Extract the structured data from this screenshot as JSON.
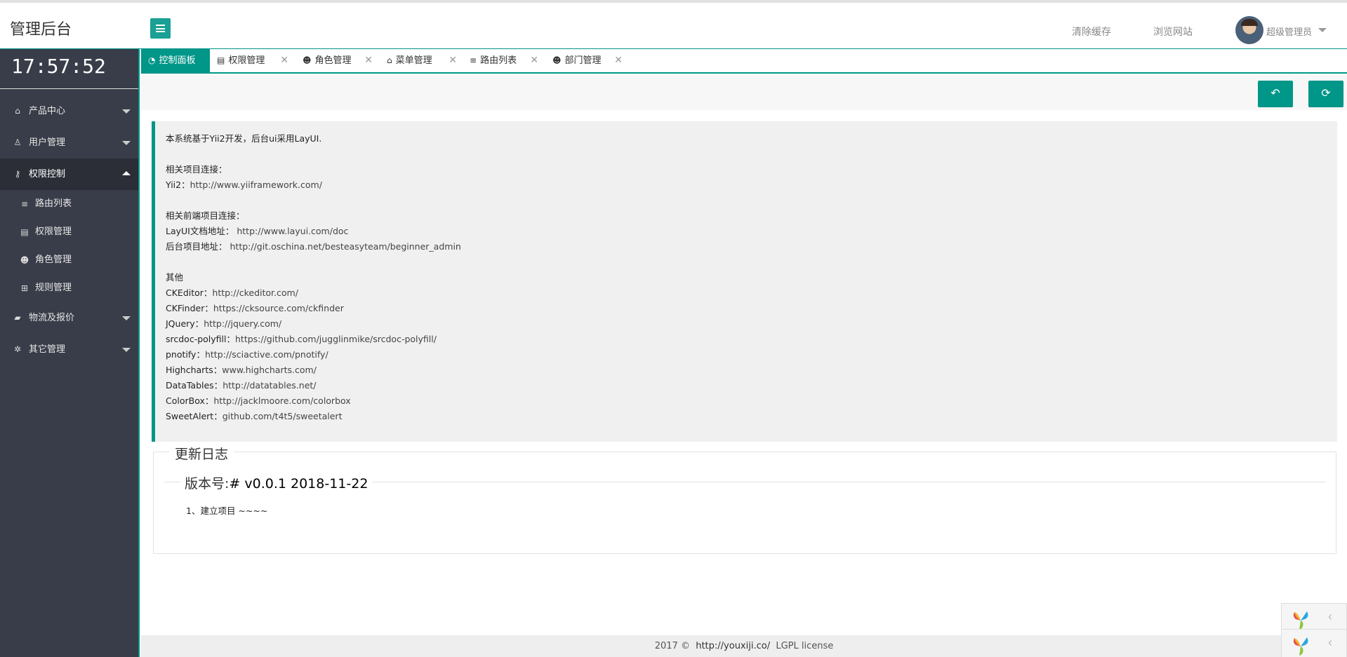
{
  "header": {
    "title": "管理后台",
    "clear_cache": "清除缓存",
    "browse_site": "浏览网站",
    "user_name": "超级管理员"
  },
  "sidebar": {
    "clock": "17:57:52",
    "items": [
      {
        "label": "产品中心",
        "icon": "home-icon"
      },
      {
        "label": "用户管理",
        "icon": "user-icon"
      },
      {
        "label": "权限控制",
        "icon": "key-icon"
      },
      {
        "label": "物流及报价",
        "icon": "truck-icon"
      },
      {
        "label": "其它管理",
        "icon": "gear-icon"
      }
    ],
    "sub_items": [
      {
        "label": "路由列表",
        "icon": "list-icon"
      },
      {
        "label": "权限管理",
        "icon": "id-card-icon"
      },
      {
        "label": "角色管理",
        "icon": "users-icon"
      },
      {
        "label": "规则管理",
        "icon": "basket-icon"
      }
    ]
  },
  "tabs": [
    {
      "label": "控制面板",
      "icon": "dashboard-icon",
      "active": true
    },
    {
      "label": "权限管理",
      "icon": "id-card-icon"
    },
    {
      "label": "角色管理",
      "icon": "users-icon"
    },
    {
      "label": "菜单管理",
      "icon": "home-icon"
    },
    {
      "label": "路由列表",
      "icon": "list-icon"
    },
    {
      "label": "部门管理",
      "icon": "users-icon"
    }
  ],
  "intro": {
    "line1": "本系统基于Yii2开发，后台ui采用LayUI.",
    "related_title": "相关项目连接：",
    "yii2_label": "Yii2：",
    "yii2_url": "http://www.yiiframework.com/",
    "frontend_title": "相关前端项目连接：",
    "layui_label": "LayUI文档地址：",
    "layui_url": "http://www.layui.com/doc",
    "backend_label": "后台项目地址：",
    "backend_url": "http://git.oschina.net/besteasyteam/beginner_admin",
    "other_title": "其他",
    "others": [
      {
        "label": "CKEditor：",
        "url": "http://ckeditor.com/"
      },
      {
        "label": "CKFinder：",
        "url": "https://cksource.com/ckfinder"
      },
      {
        "label": "JQuery：",
        "url": "http://jquery.com/"
      },
      {
        "label": "srcdoc-polyfill：",
        "url": "https://github.com/jugglinmike/srcdoc-polyfill/"
      },
      {
        "label": "pnotify：",
        "url": "http://sciactive.com/pnotify/"
      },
      {
        "label": "Highcharts：",
        "url": "www.highcharts.com/"
      },
      {
        "label": "DataTables：",
        "url": "http://datatables.net/"
      },
      {
        "label": "ColorBox：",
        "url": "http://jacklmoore.com/colorbox"
      },
      {
        "label": "SweetAlert：",
        "url": "github.com/t4t5/sweetalert"
      }
    ]
  },
  "changelog": {
    "title": "更新日志",
    "version_prefix": "版本号:",
    "version": "# v0.0.1 2018-11-22",
    "entry": "1、建立项目 ~~~~"
  },
  "footer": {
    "copyright": "2017 ©",
    "link": "http://youxiji.co/",
    "license": "LGPL license"
  },
  "colors": {
    "accent": "#009688",
    "sidebar": "#393d49"
  }
}
